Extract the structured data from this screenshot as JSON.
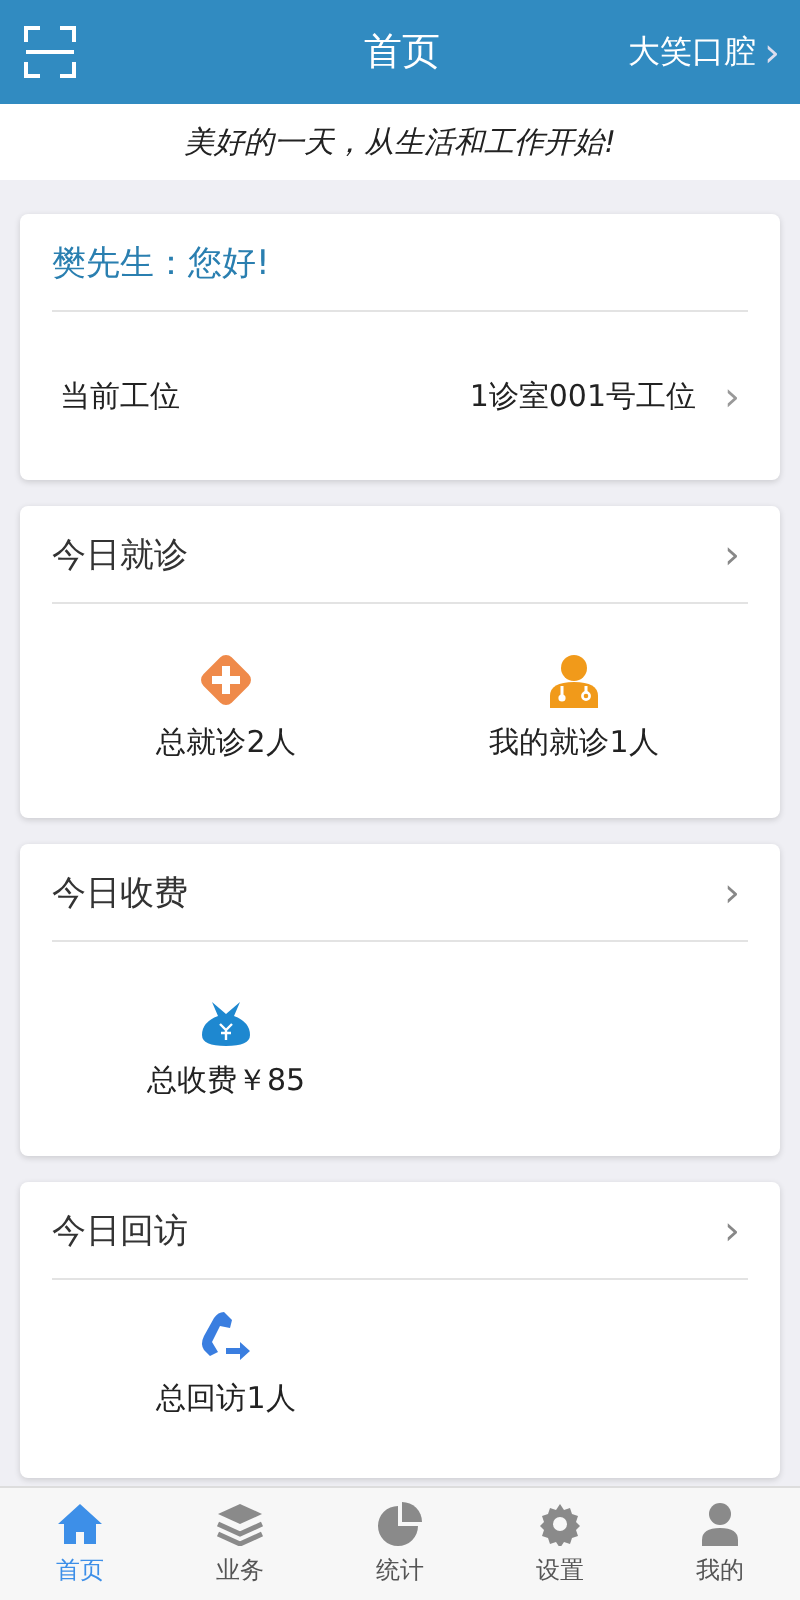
{
  "header": {
    "title": "首页",
    "clinic": "大笑口腔",
    "chevron": "›"
  },
  "slogan": "美好的一天，从生活和工作开始!",
  "greeting_card": {
    "greeting": "樊先生：您好!",
    "row_label": "当前工位",
    "row_value": "1诊室001号工位",
    "chevron": "›"
  },
  "sections": [
    {
      "title": "今日就诊",
      "chevron": "›",
      "items": [
        {
          "kind": "cross",
          "label": "总就诊2人"
        },
        {
          "kind": "doctor",
          "label": "我的就诊1人"
        }
      ]
    },
    {
      "title": "今日收费",
      "chevron": "›",
      "items": [
        {
          "kind": "moneybag",
          "label": "总收费￥85"
        }
      ]
    },
    {
      "title": "今日回访",
      "chevron": "›",
      "items": [
        {
          "kind": "phone",
          "label": "总回访1人"
        }
      ]
    }
  ],
  "tabs": [
    {
      "kind": "home",
      "label": "首页",
      "selected": true
    },
    {
      "kind": "layers",
      "label": "业务",
      "selected": false
    },
    {
      "kind": "pie",
      "label": "统计",
      "selected": false
    },
    {
      "kind": "gear",
      "label": "设置",
      "selected": false
    },
    {
      "kind": "person",
      "label": "我的",
      "selected": false
    }
  ]
}
